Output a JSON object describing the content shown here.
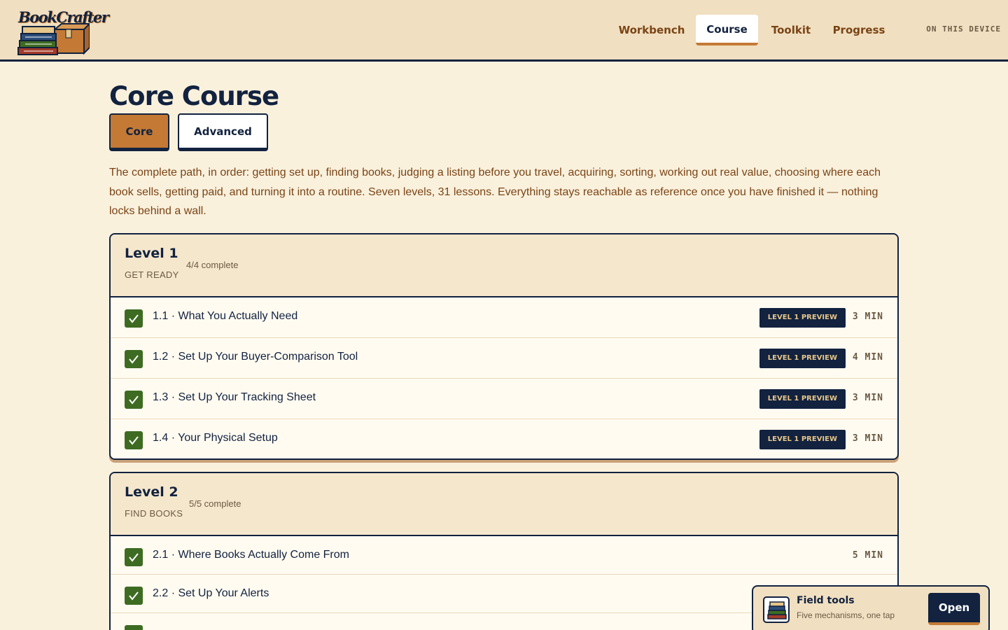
{
  "brand": {
    "name": "BookCrafter"
  },
  "nav": {
    "items": [
      {
        "label": "Workbench"
      },
      {
        "label": "Course"
      },
      {
        "label": "Toolkit"
      },
      {
        "label": "Progress"
      }
    ],
    "active": "Course",
    "device_label": "ON THIS DEVICE"
  },
  "page": {
    "title": "Core Course",
    "tabs": [
      {
        "label": "Core"
      },
      {
        "label": "Advanced"
      }
    ],
    "active_tab": "Core",
    "intro": "The complete path, in order: getting set up, finding books, judging a listing before you travel, acquiring, sorting, working out real value, choosing where each book sells, getting paid, and turning it into a routine. Seven levels, 31 lessons. Everything stays reachable as reference once you have finished it — nothing locks behind a wall."
  },
  "levels": [
    {
      "name": "Level 1",
      "subtitle": "GET READY",
      "progress": "4/4 complete",
      "lessons": [
        {
          "title": "1.1 · What You Actually Need",
          "badge": "LEVEL 1 PREVIEW",
          "duration": "3 MIN",
          "completed": true
        },
        {
          "title": "1.2 · Set Up Your Buyer-Comparison Tool",
          "badge": "LEVEL 1 PREVIEW",
          "duration": "4 MIN",
          "completed": true
        },
        {
          "title": "1.3 · Set Up Your Tracking Sheet",
          "badge": "LEVEL 1 PREVIEW",
          "duration": "3 MIN",
          "completed": true
        },
        {
          "title": "1.4 · Your Physical Setup",
          "badge": "LEVEL 1 PREVIEW",
          "duration": "3 MIN",
          "completed": true
        }
      ]
    },
    {
      "name": "Level 2",
      "subtitle": "FIND BOOKS",
      "progress": "5/5 complete",
      "lessons": [
        {
          "title": "2.1 · Where Books Actually Come From",
          "duration": "5 MIN",
          "completed": true
        },
        {
          "title": "2.2 · Set Up Your Alerts",
          "completed": true
        }
      ]
    }
  ],
  "field_tools": {
    "title": "Field tools",
    "subtitle": "Five mechanisms, one tap",
    "button": "Open"
  },
  "colors": {
    "navy": "#12223f",
    "copper": "#c47a35",
    "brown": "#7a4416",
    "cream": "#faf1dd",
    "header": "#f0dfc0",
    "check_green": "#3e6b22"
  }
}
